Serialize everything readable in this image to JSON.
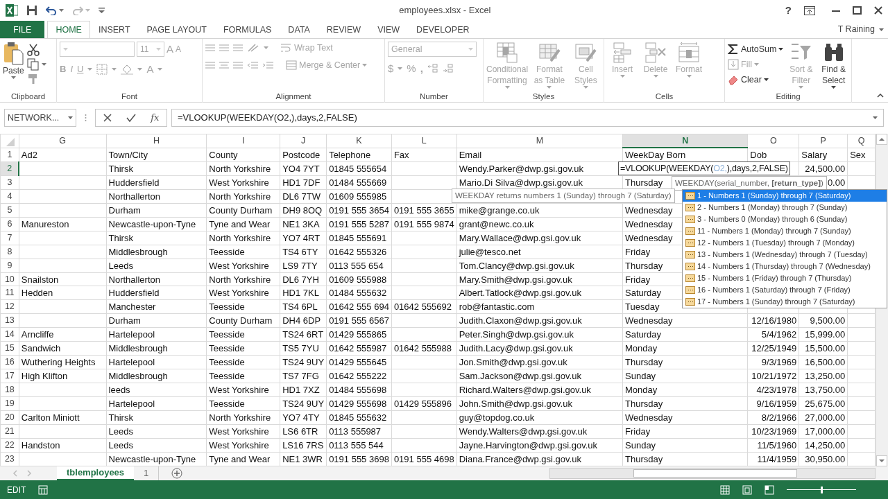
{
  "window": {
    "title": "employees.xlsx - Excel",
    "help": "?"
  },
  "ribbon_tabs": [
    {
      "label": "FILE",
      "kind": "file",
      "selected": false
    },
    {
      "label": "HOME",
      "kind": "tab",
      "selected": true
    },
    {
      "label": "INSERT",
      "kind": "tab",
      "selected": false
    },
    {
      "label": "PAGE LAYOUT",
      "kind": "tab",
      "selected": false
    },
    {
      "label": "FORMULAS",
      "kind": "tab",
      "selected": false
    },
    {
      "label": "DATA",
      "kind": "tab",
      "selected": false
    },
    {
      "label": "REVIEW",
      "kind": "tab",
      "selected": false
    },
    {
      "label": "VIEW",
      "kind": "tab",
      "selected": false
    },
    {
      "label": "DEVELOPER",
      "kind": "tab",
      "selected": false
    }
  ],
  "account": {
    "name": "T Raining"
  },
  "ribbon": {
    "groups": [
      {
        "kind": "clipboard",
        "label": "Clipboard",
        "paste": "Paste"
      },
      {
        "kind": "font",
        "label": "Font",
        "disabled": true,
        "size": "11",
        "bold": "B",
        "italic": "I",
        "underline": "U",
        "grow": "A",
        "shrink": "A",
        "font_color": "A"
      },
      {
        "kind": "alignment",
        "label": "Alignment",
        "disabled": true,
        "wrap": "Wrap Text",
        "merge": "Merge & Center"
      },
      {
        "kind": "number",
        "label": "Number",
        "disabled": true,
        "format": "General",
        "currency": "$",
        "percent": "%",
        "comma": ","
      },
      {
        "kind": "large",
        "label": "Styles",
        "buttons": [
          {
            "label": "Conditional Formatting",
            "disabled": true
          },
          {
            "label": "Format as Table",
            "disabled": true
          },
          {
            "label": "Cell Styles",
            "disabled": true
          }
        ]
      },
      {
        "kind": "large",
        "label": "Cells",
        "buttons": [
          {
            "label": "Insert",
            "disabled": true
          },
          {
            "label": "Delete",
            "disabled": true
          },
          {
            "label": "Format",
            "disabled": true
          }
        ]
      },
      {
        "kind": "editing",
        "label": "Editing",
        "small": [
          {
            "label": "AutoSum",
            "disabled": false
          },
          {
            "label": "Fill",
            "disabled": true
          },
          {
            "label": "Clear",
            "disabled": false
          }
        ],
        "large": [
          {
            "label": "Sort & Filter",
            "disabled": true
          },
          {
            "label": "Find & Select",
            "disabled": false
          }
        ]
      }
    ]
  },
  "formula_bar": {
    "name_box": "NETWORK...",
    "function_label": "fx",
    "formula": "=VLOOKUP(WEEKDAY(O2,),days,2,FALSE)"
  },
  "grid": {
    "columns": [
      {
        "letter": "G",
        "kind": "text",
        "selected": false
      },
      {
        "letter": "H",
        "kind": "text",
        "selected": false
      },
      {
        "letter": "I",
        "kind": "text",
        "selected": false
      },
      {
        "letter": "J",
        "kind": "text",
        "selected": false
      },
      {
        "letter": "K",
        "kind": "text",
        "selected": false
      },
      {
        "letter": "L",
        "kind": "text",
        "selected": false
      },
      {
        "letter": "M",
        "kind": "text",
        "selected": false
      },
      {
        "letter": "N",
        "kind": "text",
        "selected": true
      },
      {
        "letter": "O",
        "kind": "number",
        "selected": false
      },
      {
        "letter": "P",
        "kind": "number",
        "selected": false
      },
      {
        "letter": "Q",
        "kind": "text",
        "selected": false
      }
    ],
    "rows": [
      {
        "number": "1",
        "selected": false,
        "cells": {
          "G": "Ad2",
          "H": "Town/City",
          "I": "County",
          "J": "Postcode",
          "K": "Telephone",
          "L": "Fax",
          "M": "Email",
          "N": "WeekDay Born",
          "O": "Dob",
          "P": "Salary",
          "Q": "Sex"
        }
      },
      {
        "number": "2",
        "selected": true,
        "cells": {
          "H": "Thirsk",
          "I": "North Yorkshire",
          "J": "YO4 7YT",
          "K": "01845 555654",
          "M": "Wendy.Parker@dwp.gsi.gov.uk",
          "P": "24,500.00"
        }
      },
      {
        "number": "3",
        "selected": false,
        "cells": {
          "H": "Huddersfield",
          "I": "West Yorkshire",
          "J": "HD1 7DF",
          "K": "01484 555669",
          "M": "Mario.Di Silva@dwp.gsi.gov.uk",
          "N": "Thursday",
          "P": "0.00"
        }
      },
      {
        "number": "4",
        "selected": false,
        "cells": {
          "H": "Northallerton",
          "I": "North Yorkshire",
          "J": "DL6 7TW",
          "K": "01609 555985"
        }
      },
      {
        "number": "5",
        "selected": false,
        "cells": {
          "H": "Durham",
          "I": "County Durham",
          "J": "DH9 8OQ",
          "K": "0191 555 3654",
          "L": "0191 555 3655",
          "M": "mike@grange.co.uk",
          "N": "Wednesday"
        }
      },
      {
        "number": "6",
        "selected": false,
        "cells": {
          "G": "Manureston",
          "H": "Newcastle-upon-Tyne",
          "I": "Tyne and Wear",
          "J": "NE1 3KA",
          "K": "0191 555 5287",
          "L": "0191 555 9874",
          "M": "grant@newc.co.uk",
          "N": "Wednesday"
        }
      },
      {
        "number": "7",
        "selected": false,
        "cells": {
          "H": "Thirsk",
          "I": "North Yorkshire",
          "J": "YO7 4RT",
          "K": "01845 555691",
          "M": "Mary.Wallace@dwp.gsi.gov.uk",
          "N": "Wednesday"
        }
      },
      {
        "number": "8",
        "selected": false,
        "cells": {
          "H": "Middlesbrough",
          "I": "Teesside",
          "J": "TS4 6TY",
          "K": "01642 555326",
          "M": "julie@tesco.net",
          "N": "Friday"
        }
      },
      {
        "number": "9",
        "selected": false,
        "cells": {
          "H": "Leeds",
          "I": "West Yorkshire",
          "J": "LS9 7TY",
          "K": "0113 555 654",
          "M": "Tom.Clancy@dwp.gsi.gov.uk",
          "N": "Thursday"
        }
      },
      {
        "number": "10",
        "selected": false,
        "cells": {
          "G": "Snailston",
          "H": "Northallerton",
          "I": "North Yorkshire",
          "J": "DL6 7YH",
          "K": "01609 555988",
          "M": "Mary.Smith@dwp.gsi.gov.uk",
          "N": "Friday"
        }
      },
      {
        "number": "11",
        "selected": false,
        "cells": {
          "G": "Hedden",
          "H": "Huddersfield",
          "I": "West Yorkshire",
          "J": "HD1 7KL",
          "K": "01484 555632",
          "M": "Albert.Tatlock@dwp.gsi.gov.uk",
          "N": "Saturday"
        }
      },
      {
        "number": "12",
        "selected": false,
        "cells": {
          "H": "Manchester",
          "I": "Teesside",
          "J": "TS4 6PL",
          "K": "01642 555 694",
          "L": "01642 555692",
          "M": "rob@fantastic.com",
          "N": "Tuesday"
        }
      },
      {
        "number": "13",
        "selected": false,
        "cells": {
          "H": "Durham",
          "I": "County Durham",
          "J": "DH4 6DP",
          "K": "0191 555 6567",
          "M": "Judith.Claxon@dwp.gsi.gov.uk",
          "N": "Wednesday",
          "O": "12/16/1980",
          "P": "9,500.00"
        }
      },
      {
        "number": "14",
        "selected": false,
        "cells": {
          "G": "Arncliffe",
          "H": "Hartelepool",
          "I": "Teesside",
          "J": "TS24 6RT",
          "K": "01429 555865",
          "M": "Peter.Singh@dwp.gsi.gov.uk",
          "N": "Saturday",
          "O": "5/4/1962",
          "P": "15,999.00"
        }
      },
      {
        "number": "15",
        "selected": false,
        "cells": {
          "G": "Sandwich",
          "H": "Middlesbrough",
          "I": "Teesside",
          "J": "TS5 7YU",
          "K": "01642 555987",
          "L": "01642 555988",
          "M": "Judith.Lacy@dwp.gsi.gov.uk",
          "N": "Monday",
          "O": "12/25/1949",
          "P": "15,500.00"
        }
      },
      {
        "number": "16",
        "selected": false,
        "cells": {
          "G": "Wuthering Heights",
          "H": "Hartelepool",
          "I": "Teesside",
          "J": "TS24 9UY",
          "K": "01429 555645",
          "M": "Jon.Smith@dwp.gsi.gov.uk",
          "N": "Thursday",
          "O": "9/3/1969",
          "P": "16,500.00"
        }
      },
      {
        "number": "17",
        "selected": false,
        "cells": {
          "G": "High Klifton",
          "H": "Middlesbrough",
          "I": "Teesside",
          "J": "TS7 7FG",
          "K": "01642 555222",
          "M": "Sam.Jackson@dwp.gsi.gov.uk",
          "N": "Sunday",
          "O": "10/21/1972",
          "P": "13,250.00"
        }
      },
      {
        "number": "18",
        "selected": false,
        "cells": {
          "H": "leeds",
          "I": "West Yorkshire",
          "J": "HD1 7XZ",
          "K": "01484 555698",
          "M": "Richard.Walters@dwp.gsi.gov.uk",
          "N": "Monday",
          "O": "4/23/1978",
          "P": "13,750.00"
        }
      },
      {
        "number": "19",
        "selected": false,
        "cells": {
          "H": "Hartelepool",
          "I": "Teesside",
          "J": "TS24 9UY",
          "K": "01429 555698",
          "L": "01429 555896",
          "M": "John.Smith@dwp.gsi.gov.uk",
          "N": "Thursday",
          "O": "9/16/1959",
          "P": "25,675.00"
        }
      },
      {
        "number": "20",
        "selected": false,
        "cells": {
          "G": "Carlton Miniott",
          "H": "Thirsk",
          "I": "North Yorkshire",
          "J": "YO7 4TY",
          "K": "01845 555632",
          "M": "guy@topdog.co.uk",
          "N": "Wednesday",
          "O": "8/2/1966",
          "P": "27,000.00"
        }
      },
      {
        "number": "21",
        "selected": false,
        "cells": {
          "H": "Leeds",
          "I": "West Yorkshire",
          "J": "LS6 6TR",
          "K": "0113 555987",
          "M": "Wendy.Walters@dwp.gsi.gov.uk",
          "N": "Friday",
          "O": "10/23/1969",
          "P": "17,000.00"
        }
      },
      {
        "number": "22",
        "selected": false,
        "cells": {
          "G": "Handston",
          "H": "Leeds",
          "I": "West Yorkshire",
          "J": "LS16 7RS",
          "K": "0113 555 544",
          "M": "Jayne.Harvington@dwp.gsi.gov.uk",
          "N": "Sunday",
          "O": "11/5/1960",
          "P": "14,250.00"
        }
      },
      {
        "number": "23",
        "selected": false,
        "cells": {
          "H": "Newcastle-upon-Tyne",
          "I": "Tyne and Wear",
          "J": "NE1 3WR",
          "K": "0191 555 3698",
          "L": "0191 555 4698",
          "M": "Diana.France@dwp.gsi.gov.uk",
          "N": "Thursday",
          "O": "11/4/1959",
          "P": "30,950.00"
        }
      }
    ]
  },
  "cell_editor": {
    "parts": [
      {
        "text": "=VLOOKUP(WEEKDAY(",
        "kind": "plain"
      },
      {
        "text": "O2,",
        "kind": "reference"
      },
      {
        "text": "),days,2,FALSE)",
        "kind": "plain"
      }
    ]
  },
  "function_tooltip": {
    "text": "WEEKDAY(serial_number, **[return_type]**)"
  },
  "description_tooltip": {
    "text": "WEEKDAY returns numbers 1 (Sunday) through 7 (Saturday)"
  },
  "autocomplete": [
    {
      "label": "1 - Numbers 1 (Sunday) through 7 (Saturday)",
      "selected": true
    },
    {
      "label": "2 - Numbers 1 (Monday) through 7 (Sunday)",
      "selected": false
    },
    {
      "label": "3 - Numbers 0 (Monday) through 6 (Sunday)",
      "selected": false
    },
    {
      "label": "11 - Numbers 1 (Monday) through 7 (Sunday)",
      "selected": false
    },
    {
      "label": "12 - Numbers 1 (Tuesday) through 7 (Monday)",
      "selected": false
    },
    {
      "label": "13 - Numbers 1 (Wednesday) through 7 (Tuesday)",
      "selected": false
    },
    {
      "label": "14 - Numbers 1 (Thursday) through 7 (Wednesday)",
      "selected": false
    },
    {
      "label": "15 - Numbers 1 (Friday) through 7 (Thursday)",
      "selected": false
    },
    {
      "label": "16 - Numbers 1 (Saturday) through 7 (Friday)",
      "selected": false
    },
    {
      "label": "17 - Numbers 1 (Sunday) through 7 (Saturday)",
      "selected": false
    }
  ],
  "sheet_tabs": [
    {
      "label": "tblemployees",
      "selected": true
    },
    {
      "label": "1",
      "selected": false
    }
  ],
  "status_bar": {
    "mode": "EDIT",
    "zoom": {
      "level": 0.5
    }
  }
}
